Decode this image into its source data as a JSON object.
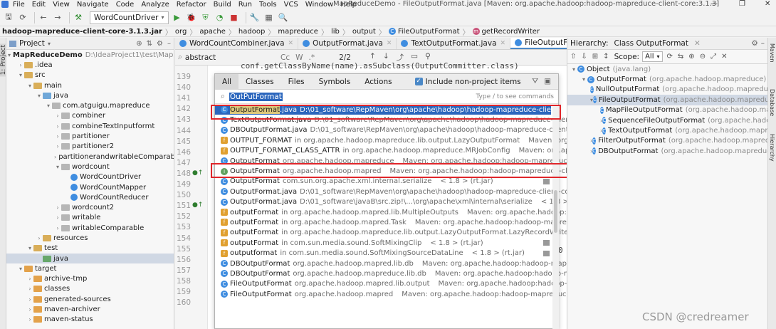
{
  "menu": [
    "File",
    "Edit",
    "View",
    "Navigate",
    "Code",
    "Analyze",
    "Refactor",
    "Build",
    "Run",
    "Tools",
    "VCS",
    "Window",
    "Help"
  ],
  "window_title": "MapReduceDemo - FileOutputFormat.java [Maven: org.apache.hadoop:hadoop-mapreduce-client-core:3.1.3]",
  "window_buttons": {
    "minimize": "—",
    "restore": "❐",
    "close": "✕"
  },
  "toolbar": {
    "run_config": "WordCountDriver"
  },
  "breadcrumb": [
    "hadoop-mapreduce-client-core-3.1.3.jar",
    "org",
    "apache",
    "hadoop",
    "mapreduce",
    "lib",
    "output",
    "FileOutputFormat",
    "getRecordWriter"
  ],
  "left_stripe": {
    "project_label": "1: Project"
  },
  "project_panel": {
    "title": "Project",
    "tree": [
      {
        "indent": 0,
        "twisty": "▾",
        "icon": "module",
        "label": "MapReduceDemo",
        "sub": "D:\\IdeaProject1\\test\\MapRec",
        "bold": true
      },
      {
        "indent": 1,
        "twisty": "›",
        "icon": "folder",
        "label": ".idea"
      },
      {
        "indent": 1,
        "twisty": "▾",
        "icon": "folder",
        "label": "src"
      },
      {
        "indent": 2,
        "twisty": "▾",
        "icon": "folder",
        "label": "main"
      },
      {
        "indent": 3,
        "twisty": "▾",
        "icon": "src",
        "label": "java"
      },
      {
        "indent": 4,
        "twisty": "▾",
        "icon": "pkg",
        "label": "com.atguigu.mapreduce"
      },
      {
        "indent": 5,
        "twisty": "›",
        "icon": "pkg",
        "label": "combiner"
      },
      {
        "indent": 5,
        "twisty": "›",
        "icon": "pkg",
        "label": "combineTextInputformt"
      },
      {
        "indent": 5,
        "twisty": "›",
        "icon": "pkg",
        "label": "partitioner"
      },
      {
        "indent": 5,
        "twisty": "›",
        "icon": "pkg",
        "label": "partitioner2"
      },
      {
        "indent": 5,
        "twisty": "›",
        "icon": "pkg",
        "label": "partitionerandwritableComparab"
      },
      {
        "indent": 5,
        "twisty": "▾",
        "icon": "pkg",
        "label": "wordcount"
      },
      {
        "indent": 6,
        "twisty": "",
        "icon": "class",
        "label": "WordCountDriver"
      },
      {
        "indent": 6,
        "twisty": "",
        "icon": "class",
        "label": "WordCountMapper"
      },
      {
        "indent": 6,
        "twisty": "",
        "icon": "class",
        "label": "WordCountReducer"
      },
      {
        "indent": 5,
        "twisty": "›",
        "icon": "pkg",
        "label": "wordcount2"
      },
      {
        "indent": 5,
        "twisty": "›",
        "icon": "pkg",
        "label": "writable"
      },
      {
        "indent": 5,
        "twisty": "›",
        "icon": "pkg",
        "label": "writableComparable"
      },
      {
        "indent": 3,
        "twisty": "›",
        "icon": "res",
        "label": "resources"
      },
      {
        "indent": 2,
        "twisty": "▾",
        "icon": "folder",
        "label": "test"
      },
      {
        "indent": 3,
        "twisty": "",
        "icon": "test",
        "label": "java",
        "selected": true
      },
      {
        "indent": 1,
        "twisty": "▾",
        "icon": "orange",
        "label": "target"
      },
      {
        "indent": 2,
        "twisty": "›",
        "icon": "orange",
        "label": "archive-tmp"
      },
      {
        "indent": 2,
        "twisty": "›",
        "icon": "orange",
        "label": "classes"
      },
      {
        "indent": 2,
        "twisty": "›",
        "icon": "orange",
        "label": "generated-sources"
      },
      {
        "indent": 2,
        "twisty": "›",
        "icon": "orange",
        "label": "maven-archiver"
      },
      {
        "indent": 2,
        "twisty": "›",
        "icon": "orange",
        "label": "maven-status"
      }
    ]
  },
  "editor_tabs": [
    {
      "label": "WordCountCombiner.java",
      "active": false
    },
    {
      "label": "OutputFormat.java",
      "active": false
    },
    {
      "label": "TextOutputFormat.java",
      "active": false
    },
    {
      "label": "FileOutputFormat.java",
      "active": true
    }
  ],
  "find_bar": {
    "query": "abstract",
    "options": [
      "Cc",
      "W",
      ".*"
    ],
    "match_count": "2/2"
  },
  "gutter": {
    "lines": [
      "139",
      "140",
      "141",
      "142",
      "143",
      "144",
      "145",
      "146",
      "147",
      "148",
      "149",
      "150",
      "151",
      "152",
      "153",
      "154",
      "155",
      "156",
      "157",
      "158",
      "159",
      "160"
    ]
  },
  "code_fragments": {
    "right_num": "0",
    "partial_line": "conf.getClassByName(name).asSubclass(OutputCommitter.class)"
  },
  "popup": {
    "tabs": [
      "All",
      "Classes",
      "Files",
      "Symbols",
      "Actions"
    ],
    "active_tab": "All",
    "include_non_project": "Include non-project items",
    "search_query": "OutPutFormat",
    "hint": "Type / to see commands",
    "results": [
      {
        "icon": "class",
        "name_hl": "OutputFormat",
        "name_rest": ".java",
        "path": "D:\\01_software\\RepMaven\\org\\apache\\hadoop\\hadoop-mapreduce-client-core\\3.1.3\\hado",
        "loc": "",
        "selected": true
      },
      {
        "icon": "class",
        "name_hl": "",
        "name_rest": "TextOutputFormat.java",
        "path": "D:\\01_software\\RepMaven\\org\\apache\\hadoop\\hadoop-mapreduce-client-core\\3.1.3\\ha",
        "loc": ""
      },
      {
        "icon": "class",
        "name_hl": "",
        "name_rest": "DBOutputFormat.java",
        "path": "D:\\01_software\\RepMaven\\org\\apache\\hadoop\\hadoop-mapreduce-client-core\\3.1.3\\ha",
        "loc": ""
      },
      {
        "icon": "field",
        "name_hl": "",
        "name_rest": "OUTPUT_FORMAT",
        "path": "in org.apache.hadoop.mapreduce.lib.output.LazyOutputFormat",
        "loc": "Maven: org.apache.ha"
      },
      {
        "icon": "field",
        "name_hl": "",
        "name_rest": "OUTPUT_FORMAT_CLASS_ATTR",
        "path": "in org.apache.hadoop.mapreduce.MRJobConfig",
        "loc": "Maven: org.apache.ha..."
      },
      {
        "icon": "class",
        "name_hl": "",
        "name_rest": "OutputFormat",
        "path": "org.apache.hadoop.mapreduce",
        "loc": "Maven: org.apache.hadoop:hadoop-mapreduce-client-core:3.1.3 (hadoop-mapreduce-client-core-3.1.3.jar)"
      },
      {
        "icon": "iface",
        "name_hl": "",
        "name_rest": "OutputFormat",
        "path": "org.apache.hadoop.mapred",
        "loc": "Maven: org.apache.hadoop:hadoop-mapreduce-client-core:3."
      },
      {
        "icon": "class",
        "name_hl": "",
        "name_rest": "OutputFormat",
        "path": "com.sun.org.apache.xml.internal.serialize",
        "loc": "< 1.8 > (rt.jar)"
      },
      {
        "icon": "class",
        "name_hl": "",
        "name_rest": "OutputFormat.java",
        "path": "D:\\01_software\\RepMaven\\org\\apache\\hadoop\\hadoop-mapreduce-client-core\\3.1.3\\hado",
        "loc": ""
      },
      {
        "icon": "class",
        "name_hl": "",
        "name_rest": "OutputFormat.java",
        "path": "D:\\01_software\\javaB\\src.zip!\\...\\org\\apache\\xml\\internal\\serialize",
        "loc": "< 1.8 > (src.zip)"
      },
      {
        "icon": "field",
        "name_hl": "",
        "name_rest": "outputFormat",
        "path": "in org.apache.hadoop.mapred.lib.MultipleOutputs",
        "loc": "Maven: org.apache.hadoop:hadoop-..."
      },
      {
        "icon": "field",
        "name_hl": "",
        "name_rest": "outputFormat",
        "path": "in org.apache.hadoop.mapred.Task",
        "loc": "Maven: org.apache.hadoop:hadoop-mapreduce-clien..."
      },
      {
        "icon": "field",
        "name_hl": "",
        "name_rest": "outputFormat",
        "path": "in org.apache.hadoop.mapreduce.lib.output.LazyOutputFormat.LazyRecordWriter",
        "loc": "Maven: org.apache.ha..."
      },
      {
        "icon": "field",
        "name_hl": "",
        "name_rest": "outputFormat",
        "path": "in com.sun.media.sound.SoftMixingClip",
        "loc": "< 1.8 > (rt.jar)"
      },
      {
        "icon": "field",
        "name_hl": "",
        "name_rest": "outputformat",
        "path": "in com.sun.media.sound.SoftMixingSourceDataLine",
        "loc": "< 1.8 > (rt.jar)"
      },
      {
        "icon": "class",
        "name_hl": "",
        "name_rest": "DBOutputFormat",
        "path": "org.apache.hadoop.mapred.lib.db",
        "loc": "Maven: org.apache.hadoop:hadoop-mapreduce-cli..."
      },
      {
        "icon": "class",
        "name_hl": "",
        "name_rest": "DBOutputFormat",
        "path": "org.apache.hadoop.mapreduce.lib.db",
        "loc": "Maven: org.apache.hadoop:hadoop-mapreduce-clie..."
      },
      {
        "icon": "class",
        "name_hl": "",
        "name_rest": "FileOutputFormat",
        "path": "org.apache.hadoop.mapred.lib.output",
        "loc": "Maven: org.apache.hadoop:hadoop-mapr..."
      },
      {
        "icon": "class",
        "name_hl": "",
        "name_rest": "FileOutputFormat",
        "path": "org.apache.hadoop.mapred",
        "loc": "Maven: org.apache.hadoop:hadoop-mapreduce-client-..."
      }
    ]
  },
  "hierarchy": {
    "title": "Hierarchy:",
    "subtitle": "Class OutputFormat",
    "scope_label": "Scope:",
    "scope_value": "All",
    "rows": [
      {
        "indent": 0,
        "twisty": "▾",
        "name": "Object",
        "pkg": "(java.lang)"
      },
      {
        "indent": 1,
        "twisty": "▾",
        "name": "OutputFormat",
        "pkg": "(org.apache.hadoop.mapreduce)"
      },
      {
        "indent": 2,
        "twisty": "",
        "name": "NullOutputFormat",
        "pkg": "(org.apache.hadoop.mapreduce."
      },
      {
        "indent": 2,
        "twisty": "▾",
        "name": "FileOutputFormat",
        "pkg": "(org.apache.hadoop.mapreduce",
        "selected": true
      },
      {
        "indent": 3,
        "twisty": "",
        "name": "MapFileOutputFormat",
        "pkg": "(org.apache.hadoop.map"
      },
      {
        "indent": 3,
        "twisty": "›",
        "name": "SequenceFileOutputFormat",
        "pkg": "(org.apache.hadoo"
      },
      {
        "indent": 3,
        "twisty": "›",
        "name": "TextOutputFormat",
        "pkg": "(org.apache.hadoop.mapre"
      },
      {
        "indent": 2,
        "twisty": "›",
        "name": "FilterOutputFormat",
        "pkg": "(org.apache.hadoop.mapredu"
      },
      {
        "indent": 2,
        "twisty": "›",
        "name": "DBOutputFormat",
        "pkg": "(org.apache.hadoop.mapreduce.li"
      }
    ]
  },
  "right_stripe": [
    "Maven",
    "Database",
    "Hierarchy"
  ],
  "watermark": "CSDN @credreamer",
  "colors": {
    "accent": "#2b66bd",
    "highlight_box": "#e0262b"
  }
}
